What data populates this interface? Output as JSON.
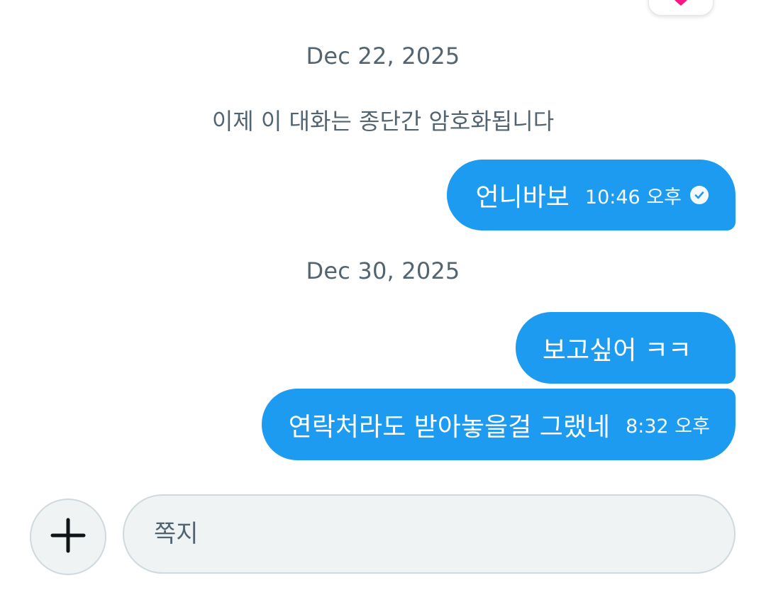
{
  "colors": {
    "bubble": "#1d9bf0",
    "secondary_text": "#536471",
    "input_bg": "#eff3f4",
    "input_border": "#cfd9de",
    "heart": "#f91880"
  },
  "top_reaction": {
    "icon": "heart-icon"
  },
  "timeline": {
    "date_1": "Dec 22, 2025",
    "encryption_note": "이제 이 대화는 종단간 암호화됩니다",
    "msg_1": {
      "text": "언니바보",
      "time": "10:46 오후",
      "status_icon": "check-circle-icon"
    },
    "date_2": "Dec 30, 2025",
    "msg_2": {
      "text": "보고싶어 ㅋㅋ"
    },
    "msg_3": {
      "text": "연락처라도 받아놓을걸 그랬네",
      "time": "8:32 오후"
    }
  },
  "composer": {
    "add_icon": "plus-icon",
    "placeholder": "쪽지",
    "value": ""
  }
}
